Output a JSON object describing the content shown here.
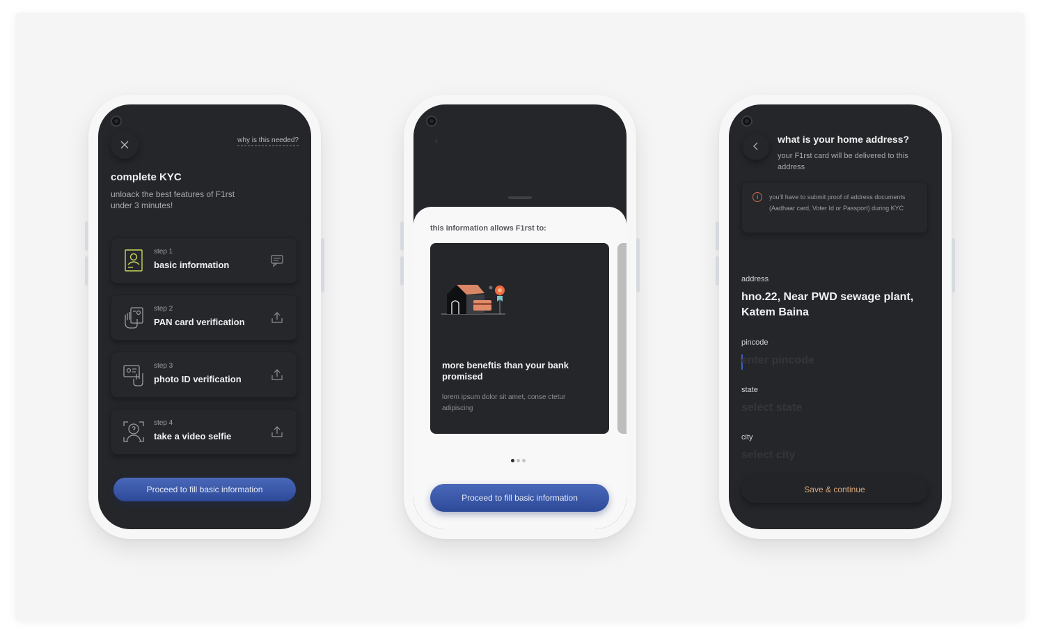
{
  "phone1": {
    "close_icon": "close-icon",
    "why_link": "why is this needed?",
    "title": "complete KYC",
    "subtitle": "unloack the best features of F1rst under 3 minutes!",
    "steps": [
      {
        "label": "step 1",
        "name": "basic information",
        "icon": "id-card-icon",
        "action_icon": "chat-icon"
      },
      {
        "label": "step 2",
        "name": "PAN card verification",
        "icon": "hand-card-icon",
        "action_icon": "upload-icon"
      },
      {
        "label": "step 3",
        "name": "photo ID verification",
        "icon": "hand-id-icon",
        "action_icon": "upload-icon"
      },
      {
        "label": "step 4",
        "name": "take a video selfie",
        "icon": "face-scan-icon",
        "action_icon": "upload-icon"
      }
    ],
    "cta": "Proceed to fill basic information",
    "colors": {
      "accent": "#3f5eb0",
      "card_icon": "#c8d85a"
    }
  },
  "phone2": {
    "sheet_label": "this information allows F1rst to:",
    "card": {
      "title": "more beneftis than your bank promised",
      "desc": "lorem ipsum dolor sit amet, conse ctetur adipiscing",
      "illustration": "house-card-icon"
    },
    "pagination": {
      "total": 3,
      "active": 1
    },
    "cta": "Proceed to fill basic information"
  },
  "phone3": {
    "title": "what is your home address?",
    "subtitle": "your F1rst card will be delivered to this address",
    "notice": "you'll have to submit proof of address documents (Aadhaar card, Voter Id or Passport) during KYC",
    "notice_icon": "info-icon",
    "fields": {
      "address": {
        "label": "address",
        "value": "hno.22, Near PWD sewage plant, Katem Baina"
      },
      "pincode": {
        "label": "pincode",
        "placeholder": "enter pincode"
      },
      "state": {
        "label": "state",
        "placeholder": "select state"
      },
      "city": {
        "label": "city",
        "placeholder": "select city"
      }
    },
    "save": "Save & continue",
    "colors": {
      "save_text": "#d9a77a",
      "notice_icon": "#d06a4d"
    }
  }
}
